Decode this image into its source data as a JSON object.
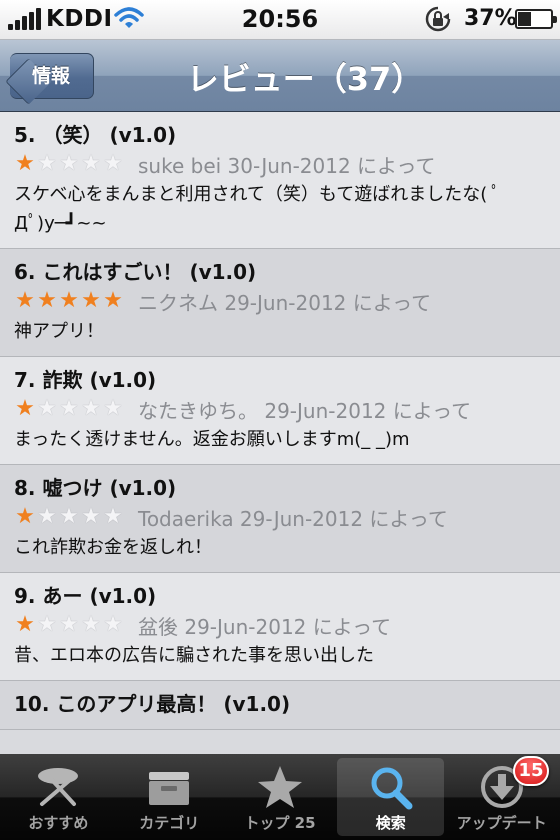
{
  "status_bar": {
    "carrier": "KDDI",
    "time": "20:56",
    "battery_percent": "37%",
    "battery_level": 0.37,
    "signal_bars": 5,
    "wifi_icon": "wifi-icon",
    "lock_icon": "rotation-lock-icon"
  },
  "nav": {
    "back_label": "情報",
    "title": "レビュー（37）"
  },
  "colors": {
    "star_on": "#f0801f",
    "nav_bar": "#8fa3bb",
    "badge": "#d41414"
  },
  "reviews": [
    {
      "title": "5. （笑） (v1.0)",
      "rating": 1,
      "author_line": "suke bei 30-Jun-2012 によって",
      "body": "スケベ心をまんまと利用されて（笑）もて遊ばれましたな( ﾟДﾟ)y─┛~~"
    },
    {
      "title": "6. これはすごい！ (v1.0)",
      "rating": 5,
      "author_line": "ニクネム 29-Jun-2012 によって",
      "body": "神アプリ！"
    },
    {
      "title": "7. 詐欺 (v1.0)",
      "rating": 1,
      "author_line": "なたきゆち。 29-Jun-2012 によって",
      "body": "まったく透けません。返金お願いしますm(_ _)m"
    },
    {
      "title": "8. 嘘つけ (v1.0)",
      "rating": 1,
      "author_line": "Todaerika 29-Jun-2012 によって",
      "body": "これ詐欺お金を返しれ！"
    },
    {
      "title": "9. あー (v1.0)",
      "rating": 1,
      "author_line": "盆後 29-Jun-2012 によって",
      "body": "昔、エロ本の広告に騙された事を思い出した"
    },
    {
      "title": "10. このアプリ最高！ (v1.0)",
      "rating": 0,
      "author_line": "",
      "body": ""
    }
  ],
  "tabs": [
    {
      "label": "おすすめ",
      "icon": "featured-icon",
      "active": false
    },
    {
      "label": "カテゴリ",
      "icon": "categories-icon",
      "active": false
    },
    {
      "label": "トップ 25",
      "icon": "star-icon",
      "active": false
    },
    {
      "label": "検索",
      "icon": "search-icon",
      "active": true
    },
    {
      "label": "アップデート",
      "icon": "updates-icon",
      "active": false,
      "badge": "15"
    }
  ]
}
